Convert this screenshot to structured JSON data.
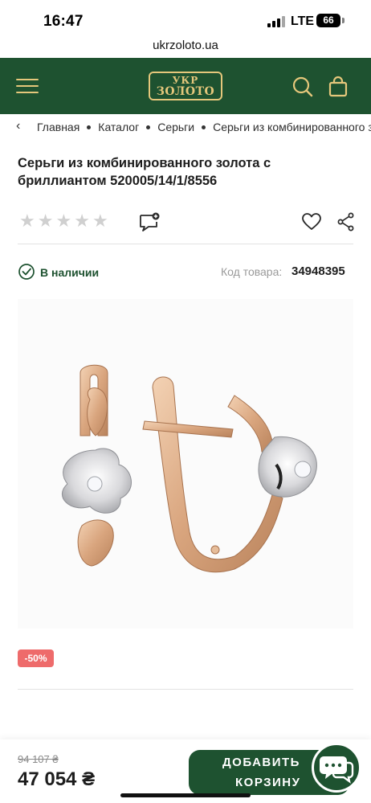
{
  "status_bar": {
    "time": "16:47",
    "network": "LTE",
    "battery": "66"
  },
  "browser": {
    "url": "ukrzoloto.ua"
  },
  "header": {
    "logo_line1": "УКР",
    "logo_line2": "ЗОЛОТО"
  },
  "breadcrumb": {
    "back": "‹",
    "items": [
      "Главная",
      "Каталог",
      "Серьги",
      "Серьги из комбинированного золота"
    ]
  },
  "product": {
    "title": "Серьги из комбинированного золота с бриллиантом 520005/14/1/8556",
    "rating_stars": 0,
    "availability": "В наличии",
    "sku_label": "Код товара:",
    "sku": "34948395",
    "discount_badge": "-50%",
    "old_price": "94 107 ₴",
    "price": "47 054 ₴"
  },
  "actions": {
    "add_to_cart_line1": "ДОБАВИТЬ",
    "add_to_cart_line2": "КОРЗИНУ"
  },
  "colors": {
    "brand_green": "#1e5230",
    "brand_gold": "#e5c77b",
    "discount_red": "#ee6b6b"
  }
}
